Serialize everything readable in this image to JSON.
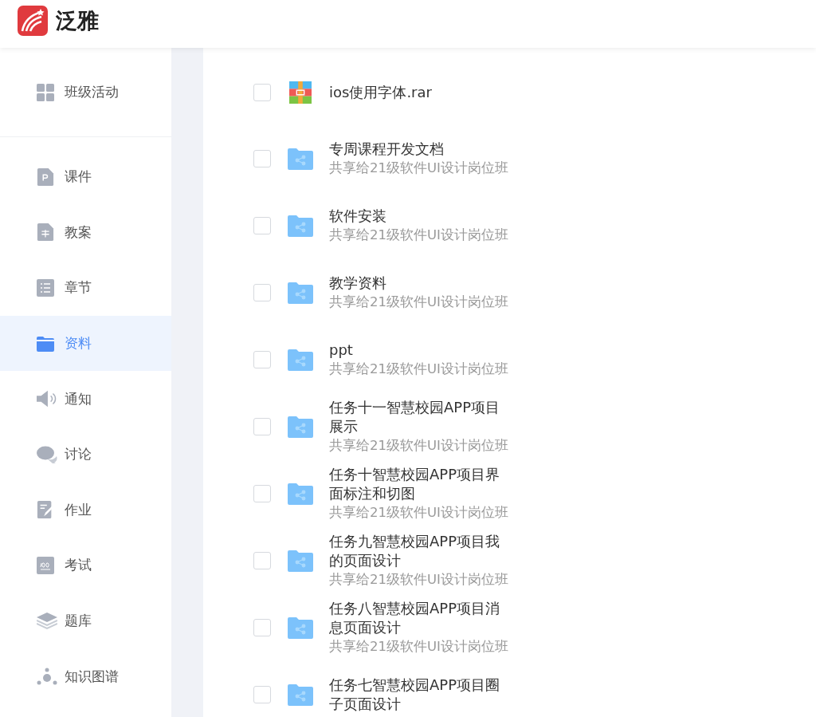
{
  "header": {
    "brand": "泛雅"
  },
  "sidebar": {
    "top_item": {
      "label": "班级活动",
      "kind": "grid",
      "selected": false
    },
    "items": [
      {
        "label": "课件",
        "kind": "doc-p",
        "selected": false
      },
      {
        "label": "教案",
        "kind": "doc",
        "selected": false
      },
      {
        "label": "章节",
        "kind": "list",
        "selected": false
      },
      {
        "label": "资料",
        "kind": "folder",
        "selected": true
      },
      {
        "label": "通知",
        "kind": "speaker",
        "selected": false
      },
      {
        "label": "讨论",
        "kind": "chat",
        "selected": false
      },
      {
        "label": "作业",
        "kind": "edit",
        "selected": false
      },
      {
        "label": "考试",
        "kind": "exam",
        "selected": false
      },
      {
        "label": "题库",
        "kind": "layers",
        "selected": false
      },
      {
        "label": "知识图谱",
        "kind": "graph",
        "selected": false
      }
    ]
  },
  "files": [
    {
      "kind": "archive",
      "name": "ios使用字体.rar",
      "checked": false
    },
    {
      "kind": "shared-folder",
      "name": "专周课程开发文档",
      "shared_with": "共享给21级软件UI设计岗位班",
      "checked": false
    },
    {
      "kind": "shared-folder",
      "name": "软件安装",
      "shared_with": "共享给21级软件UI设计岗位班",
      "checked": false
    },
    {
      "kind": "shared-folder",
      "name": "教学资料",
      "shared_with": "共享给21级软件UI设计岗位班",
      "checked": false
    },
    {
      "kind": "shared-folder",
      "name": "ppt",
      "shared_with": "共享给21级软件UI设计岗位班",
      "checked": false
    },
    {
      "kind": "shared-folder",
      "name": "任务十一智慧校园APP项目展示",
      "shared_with": "共享给21级软件UI设计岗位班",
      "checked": false
    },
    {
      "kind": "shared-folder",
      "name": "任务十智慧校园APP项目界面标注和切图",
      "shared_with": "共享给21级软件UI设计岗位班",
      "checked": false
    },
    {
      "kind": "shared-folder",
      "name": "任务九智慧校园APP项目我的页面设计",
      "shared_with": "共享给21级软件UI设计岗位班",
      "checked": false
    },
    {
      "kind": "shared-folder",
      "name": "任务八智慧校园APP项目消息页面设计",
      "shared_with": "共享给21级软件UI设计岗位班",
      "checked": false
    },
    {
      "kind": "shared-folder",
      "name": "任务七智慧校园APP项目圈子页面设计",
      "checked": false
    }
  ]
}
